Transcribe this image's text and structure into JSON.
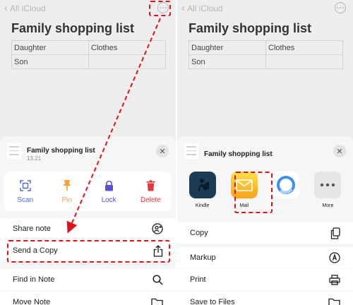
{
  "colors": {
    "red": "#e0131a",
    "accent_blue": "#4b6ae0",
    "pin_orange": "#f2a33a",
    "lock_purple": "#5a50d6",
    "delete_red": "#e6373b"
  },
  "left": {
    "back_label": "All iCloud",
    "note_title": "Family shopping list",
    "table": [
      [
        "Daughter",
        "Clothes"
      ],
      [
        "Son",
        ""
      ]
    ],
    "sheet": {
      "title": "Family shopping list",
      "subtitle": "13.21",
      "actions": [
        {
          "label": "Scan",
          "icon": "scan-icon",
          "color": "#4b6ae0"
        },
        {
          "label": "Pin",
          "icon": "pin-icon",
          "color": "#f2a33a"
        },
        {
          "label": "Lock",
          "icon": "lock-icon",
          "color": "#5a50d6"
        },
        {
          "label": "Delete",
          "icon": "trash-icon",
          "color": "#e6373b"
        }
      ],
      "menu": [
        {
          "label": "Share note",
          "icon": "share-people-icon"
        },
        {
          "label": "Send a Copy",
          "icon": "share-icon"
        },
        {
          "label": "Find in Note",
          "icon": "magnifier-icon"
        },
        {
          "label": "Move Note",
          "icon": "folder-icon"
        }
      ]
    }
  },
  "right": {
    "back_label": "All iCloud",
    "note_title": "Family shopping list",
    "table": [
      [
        "Daughter",
        "Clothes"
      ],
      [
        "Son",
        ""
      ]
    ],
    "sheet": {
      "title": "Family shopping list",
      "apps": [
        {
          "label": "Kindle",
          "icon": "kindle-icon"
        },
        {
          "label": "Mail",
          "icon": "mail-icon"
        },
        {
          "label": "",
          "icon": "browser-icon"
        },
        {
          "label": "More",
          "icon": "more-icon"
        }
      ],
      "menu": [
        {
          "label": "Copy",
          "icon": "copy-icon"
        },
        {
          "label": "Markup",
          "icon": "markup-icon"
        },
        {
          "label": "Print",
          "icon": "printer-icon"
        },
        {
          "label": "Save to Files",
          "icon": "folder-icon"
        }
      ]
    }
  }
}
